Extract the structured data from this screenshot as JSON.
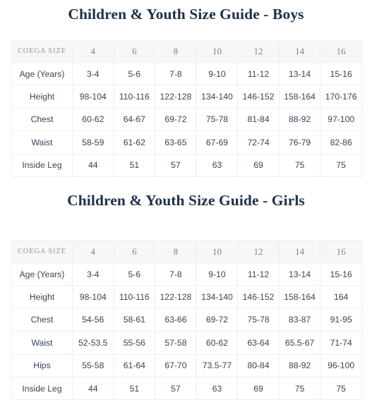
{
  "tables": [
    {
      "title": "Children & Youth Size Guide - Boys",
      "label_header": "COEGA SIZE",
      "sizes": [
        "4",
        "6",
        "8",
        "10",
        "12",
        "14",
        "16"
      ],
      "rows": [
        {
          "label": "Age (Years)",
          "values": [
            "3-4",
            "5-6",
            "7-8",
            "9-10",
            "11-12",
            "13-14",
            "15-16"
          ]
        },
        {
          "label": "Height",
          "values": [
            "98-104",
            "110-116",
            "122-128",
            "134-140",
            "146-152",
            "158-164",
            "170-176"
          ]
        },
        {
          "label": "Chest",
          "values": [
            "60-62",
            "64-67",
            "69-72",
            "75-78",
            "81-84",
            "88-92",
            "97-100"
          ]
        },
        {
          "label": "Waist",
          "values": [
            "58-59",
            "61-62",
            "63-65",
            "67-69",
            "72-74",
            "76-79",
            "82-86"
          ]
        },
        {
          "label": "Inside Leg",
          "values": [
            "44",
            "51",
            "57",
            "63",
            "69",
            "75",
            "75"
          ]
        }
      ]
    },
    {
      "title": "Children & Youth Size Guide - Girls",
      "label_header": "COEGA SIZE",
      "sizes": [
        "4",
        "6",
        "8",
        "10",
        "12",
        "14",
        "16"
      ],
      "rows": [
        {
          "label": "Age (Years)",
          "values": [
            "3-4",
            "5-6",
            "7-8",
            "9-10",
            "11-12",
            "13-14",
            "15-16"
          ]
        },
        {
          "label": "Height",
          "values": [
            "98-104",
            "110-116",
            "122-128",
            "134-140",
            "146-152",
            "158-164",
            "164"
          ]
        },
        {
          "label": "Chest",
          "values": [
            "54-56",
            "58-61",
            "63-66",
            "69-72",
            "75-78",
            "83-87",
            "91-95"
          ]
        },
        {
          "label": "Waist",
          "values": [
            "52-53.5",
            "55-56",
            "57-58",
            "60-62",
            "63-64",
            "65.5-67",
            "71-74"
          ]
        },
        {
          "label": "Hips",
          "values": [
            "55-58",
            "61-64",
            "67-70",
            "73.5-77",
            "80-84",
            "88-92",
            "96-100"
          ]
        },
        {
          "label": "Inside Leg",
          "values": [
            "44",
            "51",
            "57",
            "63",
            "69",
            "75",
            "75"
          ]
        }
      ]
    }
  ],
  "colors": {
    "title": "#1f3049",
    "header_text": "#8f969e",
    "body_text": "#384555",
    "border": "#eceef0",
    "header_background": "#f7f7f8",
    "page_background": "#ffffff"
  }
}
